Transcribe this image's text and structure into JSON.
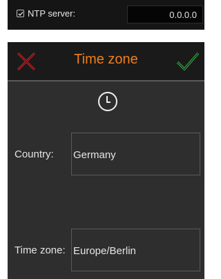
{
  "ntp": {
    "checked": true,
    "label": "NTP server:",
    "value": "0.0.0.0"
  },
  "dialog": {
    "title": "Time zone",
    "cancel_icon": "close-icon",
    "confirm_icon": "check-icon",
    "clock_icon": "clock-icon",
    "country_label": "Country:",
    "country_value": "Germany",
    "timezone_label": "Time zone:",
    "timezone_value": "Europe/Berlin"
  },
  "colors": {
    "accent": "#f07e1d",
    "cancel": "#d9272d",
    "confirm": "#2fa83a",
    "panel": "#2e2e2e",
    "header": "#1a1a1a"
  }
}
